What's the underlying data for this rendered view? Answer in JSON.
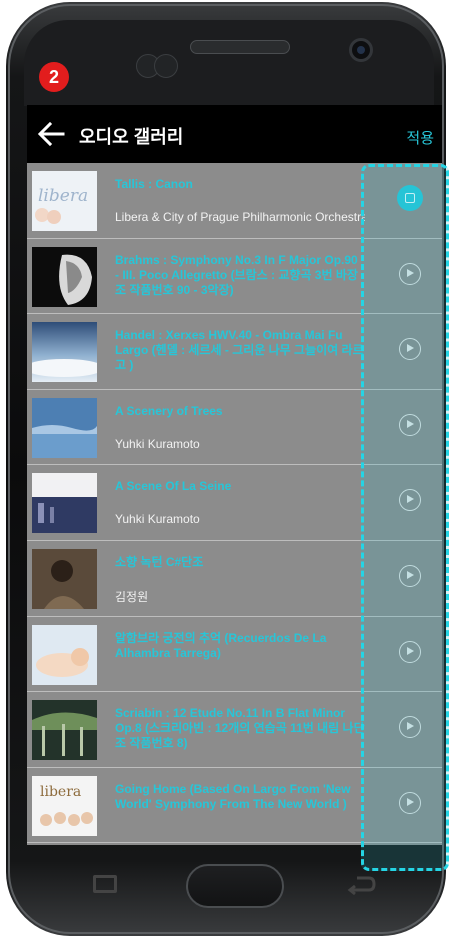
{
  "step_badge": "2",
  "appbar": {
    "title": "오디오 갤러리",
    "apply_label": "적용"
  },
  "tracks": [
    {
      "title": "Tallis : Canon",
      "artist": "Libera & City of Prague Philharmonic Orchestra",
      "state": "playing",
      "thumb": "libera-cover"
    },
    {
      "title": "Brahms : Symphony No.3 In F Major Op.90 - III. Poco Allegretto (브람스 : 교향곡 3번 바장조 작품번호 90 - 3악장)",
      "artist": "",
      "state": "stopped",
      "thumb": "portrait-bw"
    },
    {
      "title": "Handel : Xerxes HWV.40 - Ombra Mai Fu  Largo (헨델 : 세르세 - 그리운 나무 그늘이여  라르고 )",
      "artist": "",
      "state": "stopped",
      "thumb": "sky-clouds"
    },
    {
      "title": "A Scenery of Trees",
      "artist": "Yuhki Kuramoto",
      "state": "stopped",
      "thumb": "blue-lake"
    },
    {
      "title": "A Scene Of La Seine",
      "artist": "Yuhki Kuramoto",
      "state": "stopped",
      "thumb": "seine-night"
    },
    {
      "title": "소향 녹턴 C#단조",
      "artist": "김정원",
      "state": "stopped",
      "thumb": "pianist-photo"
    },
    {
      "title": "알함브라 궁전의 추억 (Recuerdos De La Alhambra Tarrega)",
      "artist": "",
      "state": "stopped",
      "thumb": "sleeping-baby"
    },
    {
      "title": "Scriabin : 12 Etude No.11 In B Flat Minor Op.8 (스크리아빈 : 12개의 연습곡 11번 내림 나단조 작품번호 8)",
      "artist": "",
      "state": "stopped",
      "thumb": "forest-dark"
    },
    {
      "title": "Going Home (Based On Largo From 'New World' Symphony  From The New World )",
      "artist": "",
      "state": "stopped",
      "thumb": "libera-boys"
    }
  ],
  "colors": {
    "accent": "#27c6d8",
    "list_bg": "#8c8c8c",
    "highlight": "#25d4e4",
    "badge": "#e21d1d"
  }
}
